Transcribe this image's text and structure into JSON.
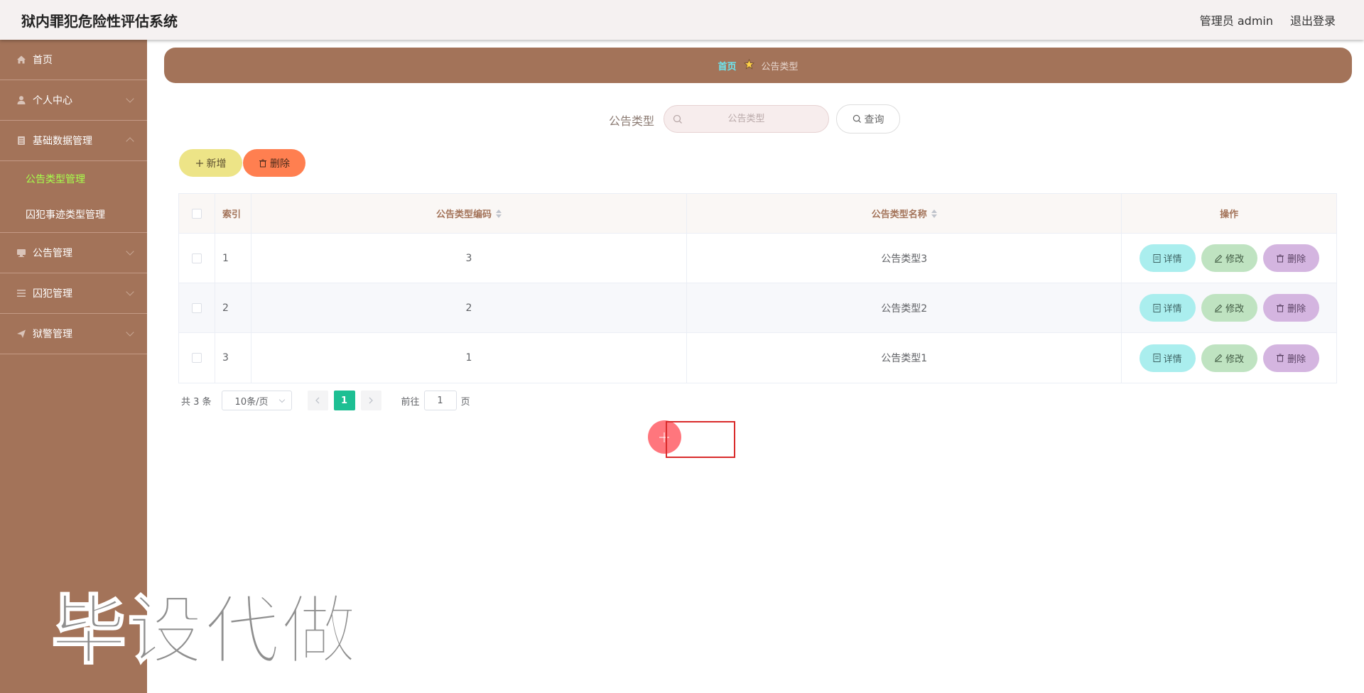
{
  "header": {
    "title": "狱内罪犯危险性评估系统",
    "user": "管理员 admin",
    "logout": "退出登录"
  },
  "sidebar": {
    "items": [
      {
        "label": "首页",
        "icon": "home-icon"
      },
      {
        "label": "个人中心",
        "icon": "user-icon"
      },
      {
        "label": "基础数据管理",
        "icon": "document-icon",
        "expanded": true,
        "children": [
          {
            "label": "公告类型管理",
            "active": true
          },
          {
            "label": "囚犯事迹类型管理"
          }
        ]
      },
      {
        "label": "公告管理",
        "icon": "monitor-icon"
      },
      {
        "label": "囚犯管理",
        "icon": "list-icon"
      },
      {
        "label": "狱警管理",
        "icon": "send-icon"
      }
    ]
  },
  "breadcrumb": {
    "home": "首页",
    "current": "公告类型"
  },
  "search": {
    "label": "公告类型",
    "placeholder": "公告类型",
    "button": "查询"
  },
  "actions": {
    "add": "新增",
    "delete": "删除"
  },
  "table": {
    "columns": [
      "索引",
      "公告类型编码",
      "公告类型名称",
      "操作"
    ],
    "rows": [
      {
        "index": "1",
        "code": "3",
        "name": "公告类型3"
      },
      {
        "index": "2",
        "code": "2",
        "name": "公告类型2"
      },
      {
        "index": "3",
        "code": "1",
        "name": "公告类型1"
      }
    ],
    "row_actions": {
      "detail": "详情",
      "edit": "修改",
      "remove": "删除"
    }
  },
  "pagination": {
    "total": "共 3 条",
    "page_size": "10条/页",
    "current": "1",
    "goto_prefix": "前往",
    "goto_value": "1",
    "goto_suffix": "页"
  },
  "watermark": "毕设代做",
  "colors": {
    "sidebar": "#a37359",
    "active_menu": "#a7ff4a",
    "crumb_home": "#6de6f0",
    "add_button": "#ede487",
    "delete_button": "#ff7f50",
    "detail_button": "#aaeeee",
    "edit_button": "#bfe3c1",
    "remove_button": "#d4b5e0",
    "pager_active": "#1dbf93"
  }
}
